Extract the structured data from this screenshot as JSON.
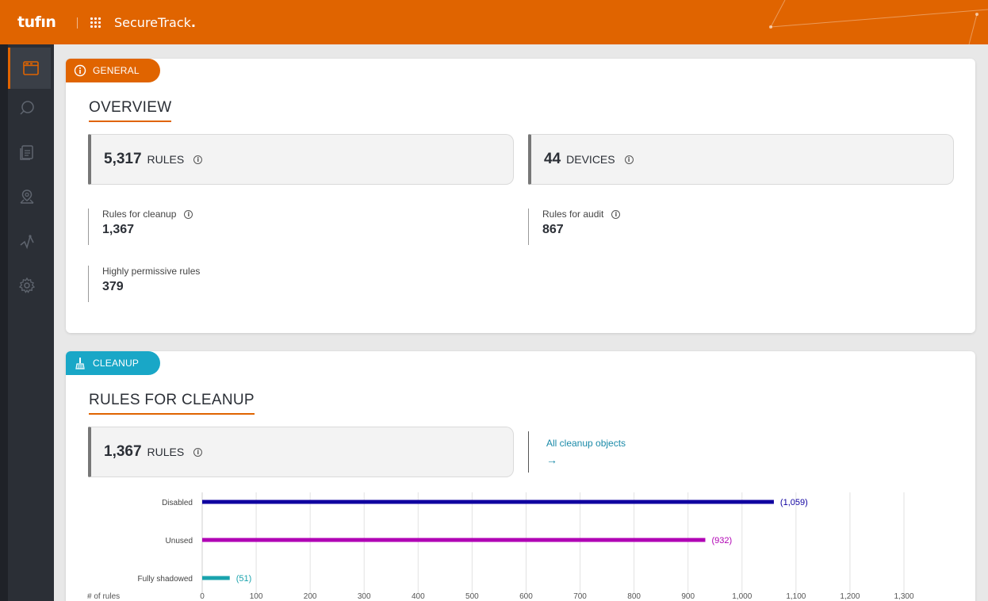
{
  "header": {
    "logo": "tufın",
    "product_name": "SecureTrack",
    "product_suffix": ".",
    "colors": {
      "brand": "#e06400"
    }
  },
  "sidebar": {
    "items": [
      {
        "icon": "browser-window-icon",
        "active": true
      },
      {
        "icon": "search-icon",
        "active": false
      },
      {
        "icon": "document-icon",
        "active": false
      },
      {
        "icon": "map-pin-icon",
        "active": false
      },
      {
        "icon": "path-graph-icon",
        "active": false
      },
      {
        "icon": "gear-icon",
        "active": false
      }
    ]
  },
  "general": {
    "tag_label": "GENERAL",
    "title": "OVERVIEW",
    "rules_count": "5,317",
    "rules_unit": "RULES",
    "devices_count": "44",
    "devices_unit": "DEVICES",
    "metrics": {
      "cleanup_label": "Rules for cleanup",
      "cleanup_value": "1,367",
      "audit_label": "Rules for audit",
      "audit_value": "867",
      "permissive_label": "Highly permissive rules",
      "permissive_value": "379"
    }
  },
  "cleanup": {
    "tag_label": "CLEANUP",
    "title": "RULES FOR CLEANUP",
    "rules_count": "1,367",
    "rules_unit": "RULES",
    "link_label": "All cleanup objects",
    "link_arrow": "→"
  },
  "chart_data": {
    "type": "bar",
    "orientation": "horizontal",
    "categories": [
      "Disabled",
      "Unused",
      "Fully shadowed"
    ],
    "values": [
      1059,
      932,
      51
    ],
    "value_labels": [
      "(1,059)",
      "(932)",
      "(51)"
    ],
    "colors": [
      "#0f00a0",
      "#b000b4",
      "#1aa3ad"
    ],
    "xlabel": "# of rules",
    "xlim": [
      0,
      1300
    ],
    "ticks": [
      0,
      100,
      200,
      300,
      400,
      500,
      600,
      700,
      800,
      900,
      1000,
      1100,
      1200,
      1300
    ],
    "tick_labels": [
      "0",
      "100",
      "200",
      "300",
      "400",
      "500",
      "600",
      "700",
      "800",
      "900",
      "1,000",
      "1,100",
      "1,200",
      "1,300"
    ],
    "grid": true
  }
}
